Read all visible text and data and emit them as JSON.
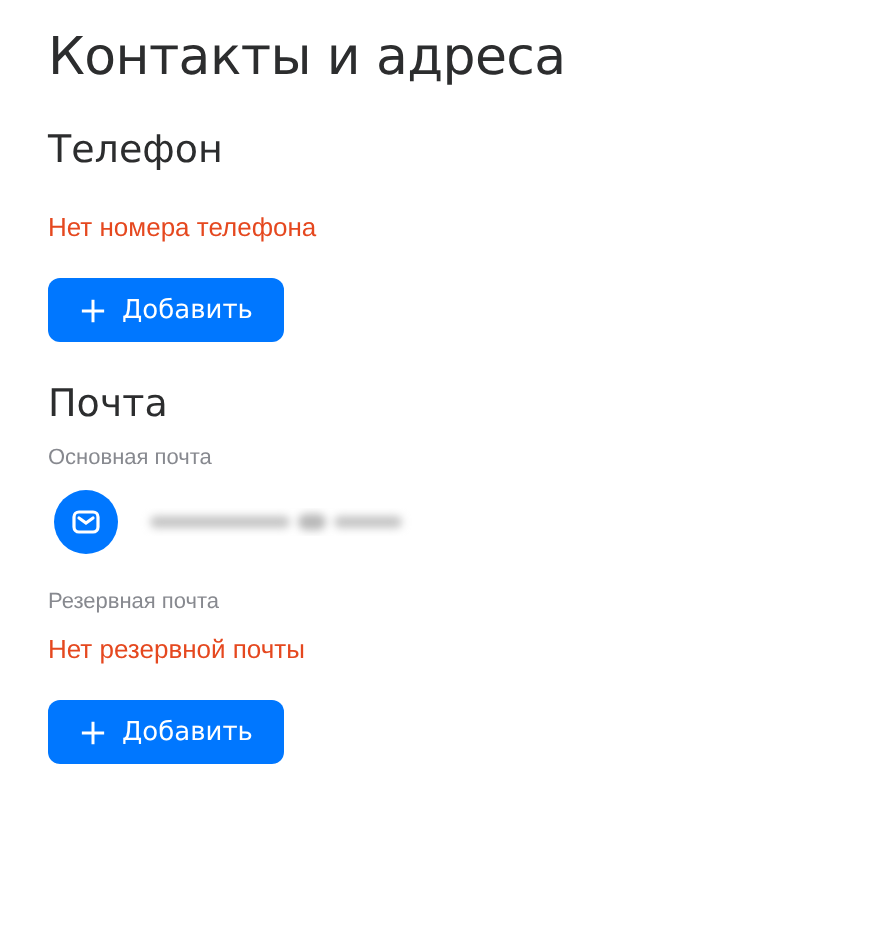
{
  "title": "Контакты и адреса",
  "sections": [
    {
      "heading": "Телефон",
      "blocks": [
        {
          "kind": "empty",
          "text": "Нет номера телефона"
        },
        {
          "kind": "button",
          "label": "Добавить"
        }
      ]
    },
    {
      "heading": "Почта",
      "blocks": [
        {
          "kind": "label",
          "text": "Основная почта"
        },
        {
          "kind": "email"
        },
        {
          "kind": "label",
          "text": "Резервная почта"
        },
        {
          "kind": "empty",
          "text": "Нет резервной почты"
        },
        {
          "kind": "button",
          "label": "Добавить"
        }
      ]
    }
  ]
}
